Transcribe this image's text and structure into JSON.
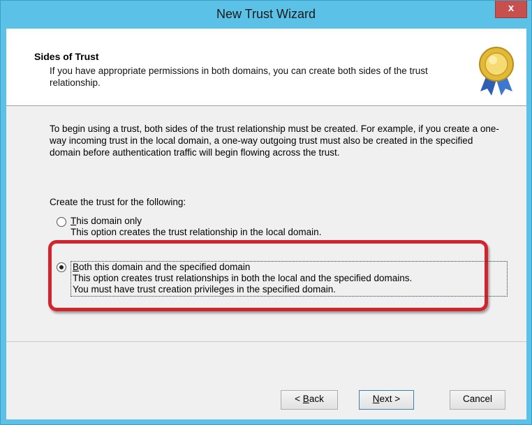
{
  "window": {
    "title": "New Trust Wizard",
    "close_label": "x"
  },
  "header": {
    "title": "Sides of Trust",
    "subtitle": "If you have appropriate permissions in both domains, you can create both sides of the trust relationship."
  },
  "body": {
    "intro": "To begin using a trust, both sides of the trust relationship must be created. For example, if you create a one-way incoming trust in the local domain, a one-way outgoing trust must also be created in the specified domain before authentication traffic will begin flowing across the trust.",
    "create_label": "Create the trust for the following:"
  },
  "options": [
    {
      "label_first": "T",
      "label_rest": "his domain only",
      "description": "This option creates the trust relationship in the local domain.",
      "selected": false
    },
    {
      "label_first": "B",
      "label_rest": "oth this domain and the specified domain",
      "description_line1": "This option creates trust relationships in both the local and the specified domains.",
      "description_line2": "You must have trust creation privileges in the specified domain.",
      "selected": true
    }
  ],
  "buttons": {
    "back_prefix": "< ",
    "back_first": "B",
    "back_rest": "ack",
    "next_first": "N",
    "next_rest": "ext >",
    "cancel": "Cancel"
  },
  "colors": {
    "titlebar": "#5bc1e6",
    "highlight": "#d3232f",
    "close": "#c7504f"
  }
}
